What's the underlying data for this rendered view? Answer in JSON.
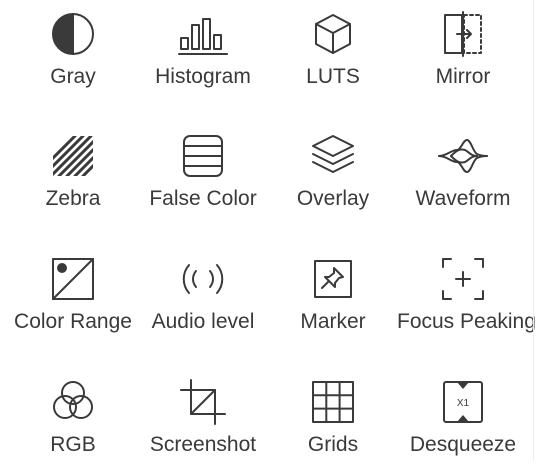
{
  "tools": [
    {
      "label": "Gray",
      "icon": "gray-icon"
    },
    {
      "label": "Histogram",
      "icon": "histogram-icon"
    },
    {
      "label": "LUTS",
      "icon": "luts-cube-icon"
    },
    {
      "label": "Mirror",
      "icon": "mirror-icon"
    },
    {
      "label": "Zebra",
      "icon": "zebra-stripes-icon"
    },
    {
      "label": "False Color",
      "icon": "false-color-icon"
    },
    {
      "label": "Overlay",
      "icon": "overlay-layers-icon"
    },
    {
      "label": "Waveform",
      "icon": "waveform-icon"
    },
    {
      "label": "Color Range",
      "icon": "color-range-icon"
    },
    {
      "label": "Audio level",
      "icon": "audio-level-icon"
    },
    {
      "label": "Marker",
      "icon": "marker-pin-icon"
    },
    {
      "label": "Focus Peaking",
      "icon": "focus-peaking-icon"
    },
    {
      "label": "RGB",
      "icon": "rgb-circles-icon"
    },
    {
      "label": "Screenshot",
      "icon": "screenshot-crop-icon"
    },
    {
      "label": "Grids",
      "icon": "grids-icon"
    },
    {
      "label": "Desqueeze",
      "icon": "desqueeze-icon"
    }
  ],
  "desqueeze_badge": "X1"
}
